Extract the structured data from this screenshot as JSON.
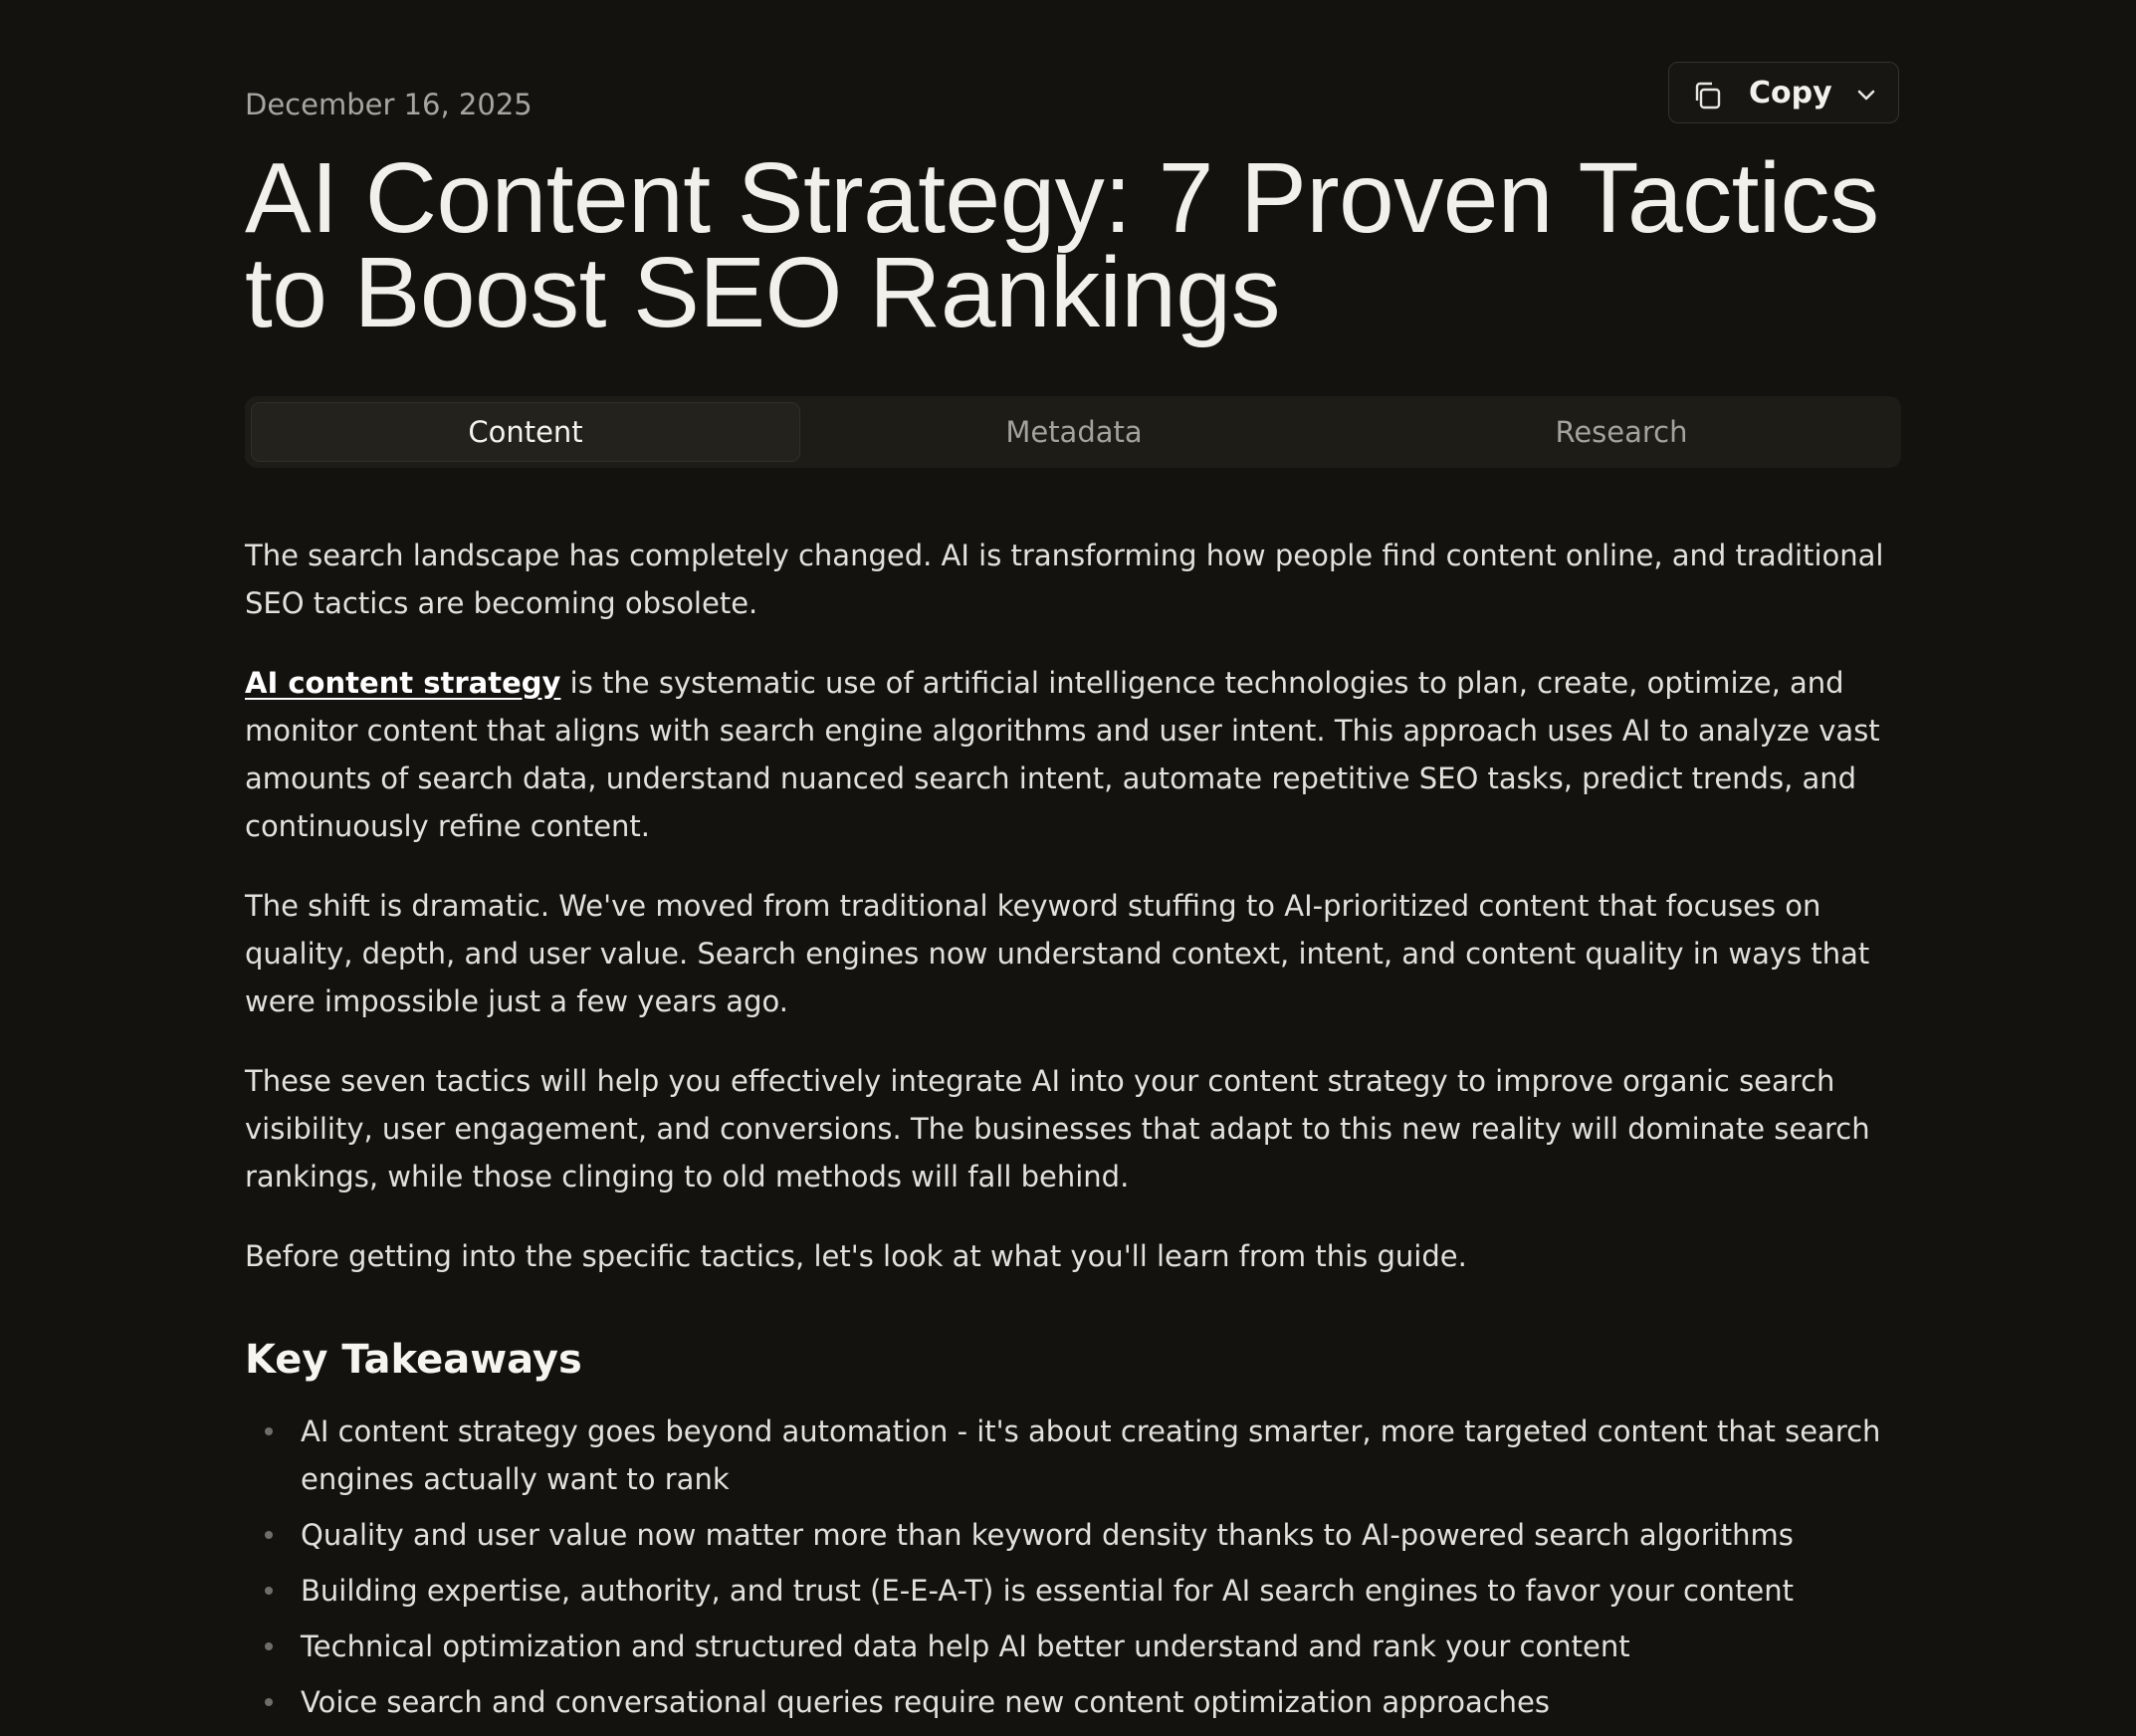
{
  "header": {
    "date": "December 16, 2025",
    "copy_button": {
      "label": "Copy",
      "icon": "copy-icon",
      "dropdown_icon": "chevron-down-icon"
    },
    "title": "AI Content Strategy: 7 Proven Tactics to Boost SEO Rankings"
  },
  "tabs": [
    {
      "label": "Content",
      "active": true
    },
    {
      "label": "Metadata",
      "active": false
    },
    {
      "label": "Research",
      "active": false
    }
  ],
  "article": {
    "p1": "The search landscape has completely changed. AI is transforming how people find content online, and traditional SEO tactics are becoming obsolete.",
    "p2_link": "AI content strategy",
    "p2_rest": " is the systematic use of artificial intelligence technologies to plan, create, optimize, and monitor content that aligns with search engine algorithms and user intent. This approach uses AI to analyze vast amounts of search data, understand nuanced search intent, automate repetitive SEO tasks, predict trends, and continuously refine content.",
    "p3": "The shift is dramatic. We've moved from traditional keyword stuffing to AI-prioritized content that focuses on quality, depth, and user value. Search engines now understand context, intent, and content quality in ways that were impossible just a few years ago.",
    "p4": "These seven tactics will help you effectively integrate AI into your content strategy to improve organic search visibility, user engagement, and conversions. The businesses that adapt to this new reality will dominate search rankings, while those clinging to old methods will fall behind.",
    "p5": "Before getting into the specific tactics, let's look at what you'll learn from this guide.",
    "takeaways_heading": "Key Takeaways",
    "takeaways": [
      "AI content strategy goes beyond automation - it's about creating smarter, more targeted content that search engines actually want to rank",
      "Quality and user value now matter more than keyword density thanks to AI-powered search algorithms",
      "Building expertise, authority, and trust (E-E-A-T) is essential for AI search engines to favor your content",
      "Technical optimization and structured data help AI better understand and rank your content",
      "Voice search and conversational queries require new content optimization approaches"
    ]
  }
}
